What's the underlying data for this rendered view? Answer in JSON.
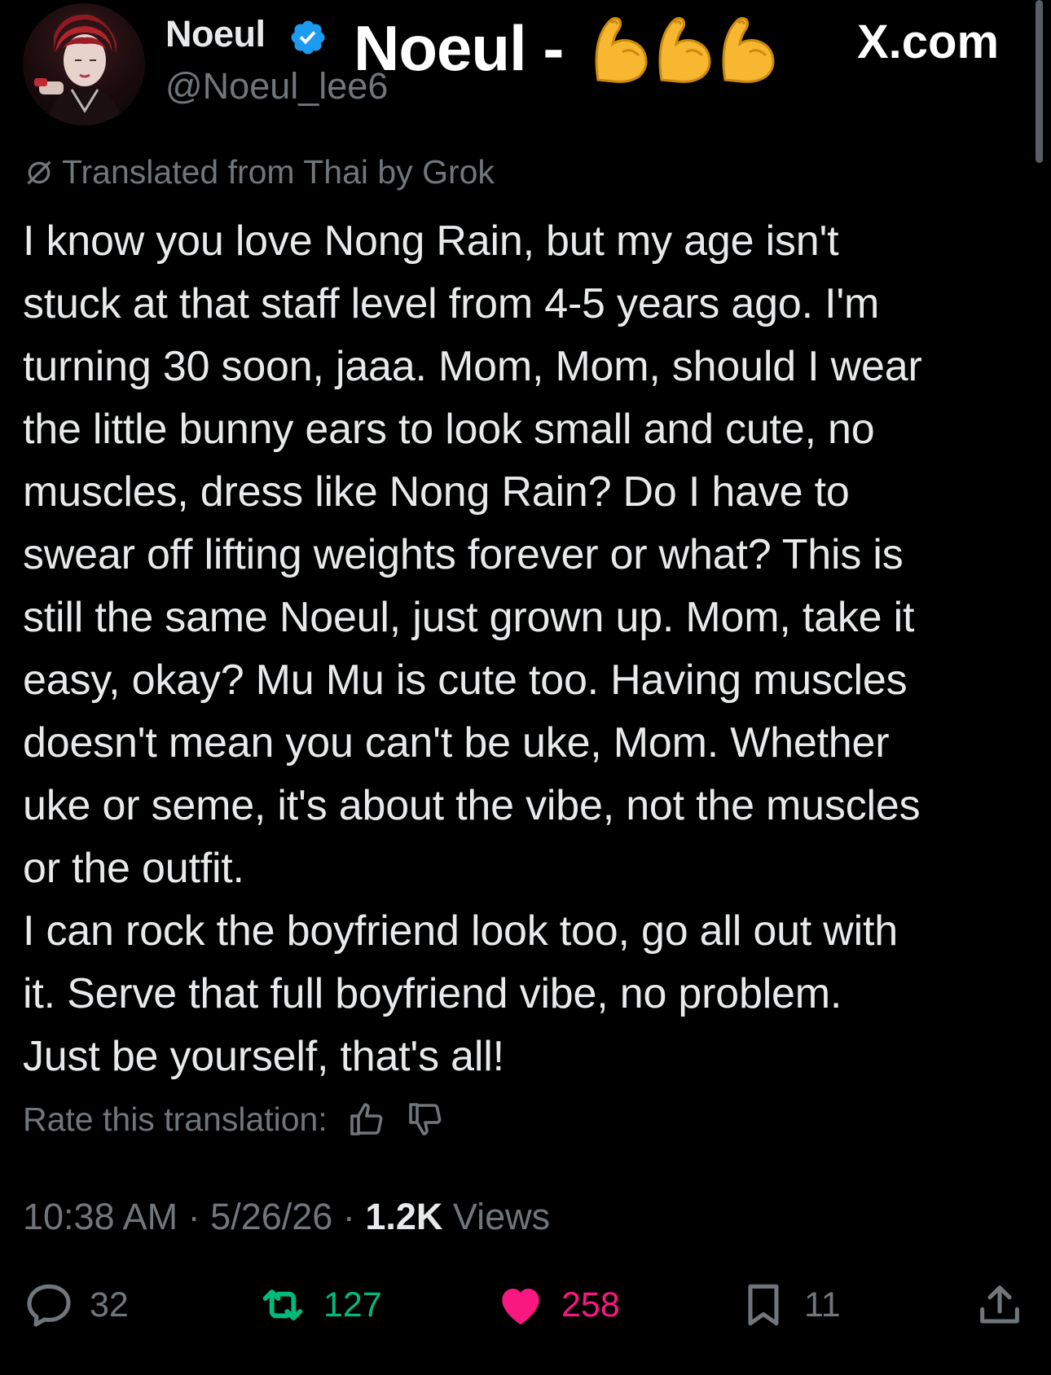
{
  "header": {
    "display_name": "Noeul",
    "handle": "@Noeul_lee6",
    "overlay_title": "Noeul -",
    "site_label": "X.com",
    "emoji_icons": [
      "flexed-biceps",
      "flexed-biceps",
      "flexed-biceps"
    ]
  },
  "tweet": {
    "translated_note": "Translated from Thai by Grok",
    "body": "I know you love Nong Rain, but my age isn't\nstuck at that staff level from 4-5 years ago. I'm\nturning 30 soon, jaaa. Mom, Mom, should I wear\nthe little bunny ears to look small and cute, no\nmuscles, dress like Nong Rain? Do I have to\nswear off lifting weights forever or what? This is\nstill the same Noeul, just grown up. Mom, take it\neasy, okay? Mu Mu is cute too. Having muscles\ndoesn't mean you can't be uke, Mom. Whether\nuke or seme, it's about the vibe, not the muscles\nor the outfit.\nI can rock the boyfriend look too, go all out with\nit. Serve that full boyfriend vibe, no problem.\nJust be yourself, that's all!",
    "rate_label": "Rate this translation:",
    "time": "10:38 AM",
    "date": "5/26/26",
    "views_count": "1.2K",
    "views_label": "Views",
    "separator": "·"
  },
  "actions": {
    "replies": "32",
    "retweets": "127",
    "likes": "258",
    "bookmarks": "11"
  },
  "colors": {
    "background": "#000000",
    "text": "#e7e9ea",
    "muted": "#71767b",
    "verified": "#1d9bf0",
    "retweet_active": "#00ba7c",
    "like_active": "#f91880"
  }
}
